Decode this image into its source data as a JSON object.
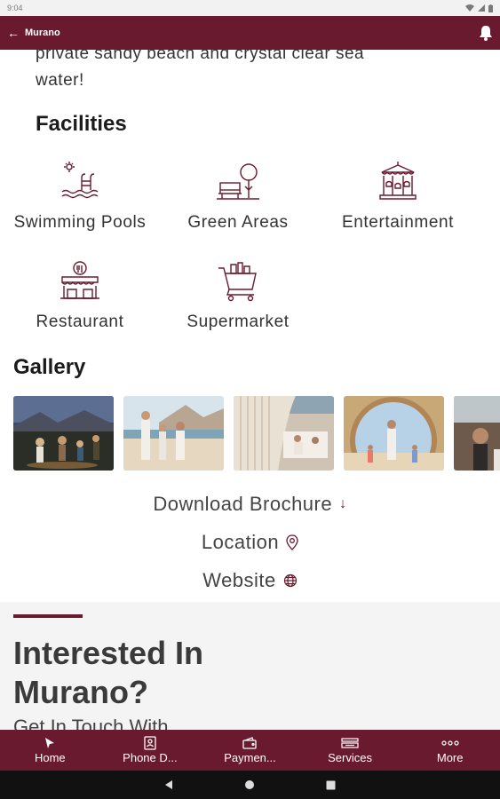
{
  "status": {
    "time": "9:04"
  },
  "appbar": {
    "title": "Murano"
  },
  "description_tail": [
    "private sandy beach and crystal clear sea",
    "water!"
  ],
  "facilities": {
    "heading": "Facilities",
    "items": [
      {
        "label": "Swimming Pools",
        "icon": "swimming-pool-icon"
      },
      {
        "label": "Green Areas",
        "icon": "green-areas-icon"
      },
      {
        "label": "Entertainment",
        "icon": "carousel-icon"
      },
      {
        "label": "Restaurant",
        "icon": "restaurant-icon"
      },
      {
        "label": "Supermarket",
        "icon": "shopping-cart-icon"
      }
    ]
  },
  "gallery": {
    "heading": "Gallery",
    "count": 5
  },
  "links": {
    "brochure": "Download Brochure",
    "location": "Location",
    "website": "Website"
  },
  "interest": {
    "title_line1": "Interested In",
    "title_line2": "Murano?",
    "subtitle": "Get In Touch With"
  },
  "bottom_nav": [
    {
      "label": "Home",
      "icon": "home-icon"
    },
    {
      "label": "Phone D...",
      "icon": "phone-directory-icon"
    },
    {
      "label": "Paymen...",
      "icon": "payment-icon"
    },
    {
      "label": "Services",
      "icon": "services-icon"
    },
    {
      "label": "More",
      "icon": "more-icon"
    }
  ],
  "colors": {
    "brand": "#6a1a2f"
  }
}
